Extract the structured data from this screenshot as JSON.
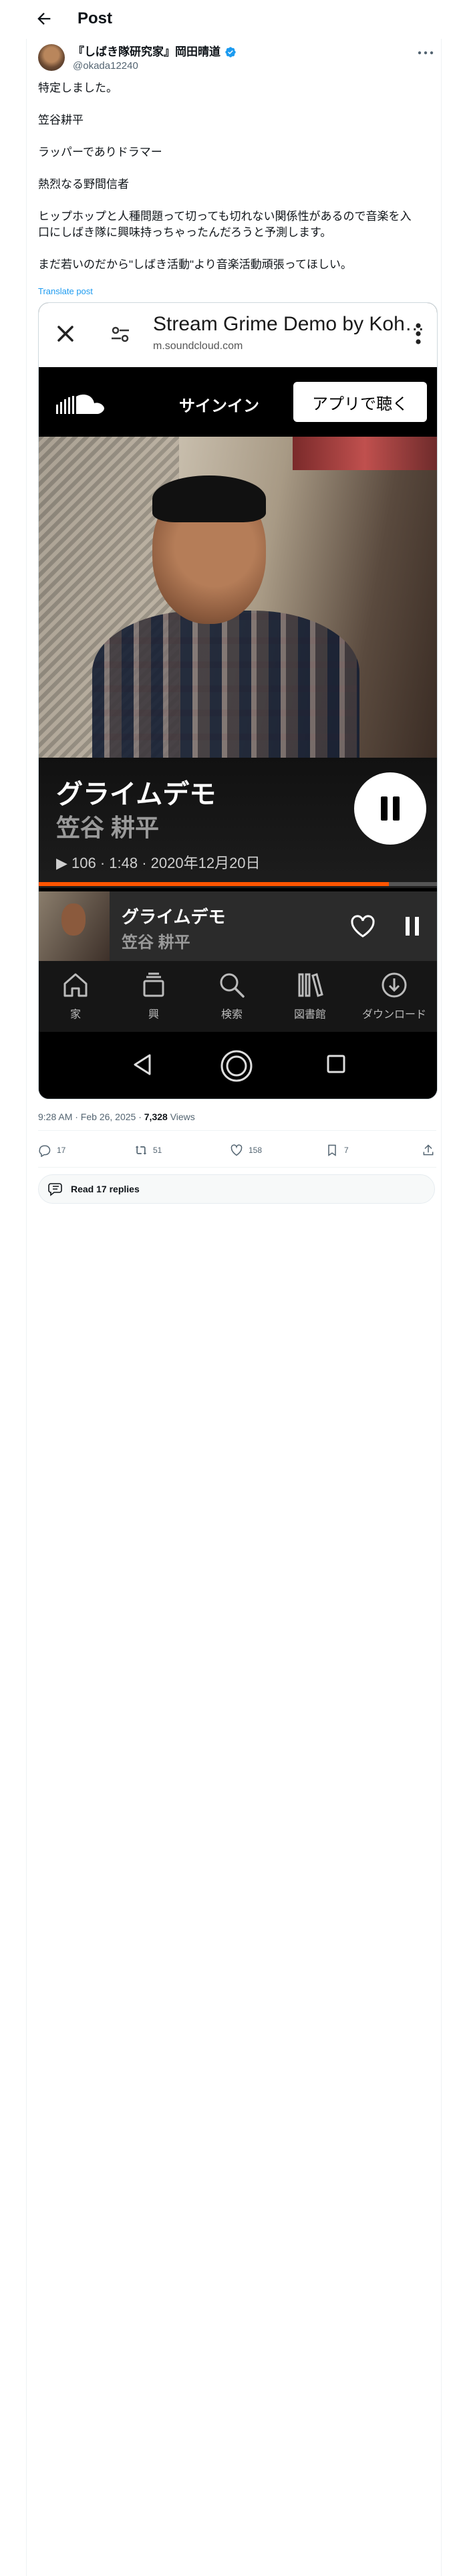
{
  "header": {
    "title": "Post"
  },
  "author": {
    "name": "『しばき隊研究家』岡田晴道",
    "handle": "@okada12240",
    "verified_color": "#1d9bf0"
  },
  "post": {
    "lines": [
      "特定しました。",
      "",
      "笠谷耕平",
      "",
      "ラッパーでありドラマー",
      "",
      "熱烈なる野間信者",
      "",
      "ヒップホップと人種問題って切っても切れない関係性があるので音楽を入",
      "口にしばき隊に興味持っちゃったんだろうと予測します。",
      "",
      "まだ若いのだから\"しばき活動\"より音楽活動頑張ってほしい。"
    ],
    "translate_label": "Translate post",
    "timestamp": "9:28 AM · Feb 26, 2025 · ",
    "views_count": "7,328",
    "views_label": " Views"
  },
  "embed": {
    "browser": {
      "page_title": "Stream Grime Demo by Koh…",
      "url": "m.soundcloud.com"
    },
    "soundcloud": {
      "signin_label": "サインイン",
      "listen_in_app_label": "アプリで聴く",
      "track_title": "グライムデモ",
      "track_artist": "笠谷 耕平",
      "track_meta": "▶ 106 · 1:48 · 2020年12月20日",
      "progress_fraction": 0.88,
      "accent_color": "#ff5500"
    },
    "tabs": [
      {
        "icon": "home-icon",
        "label": "家"
      },
      {
        "icon": "feed-icon",
        "label": "興"
      },
      {
        "icon": "search-icon",
        "label": "検索"
      },
      {
        "icon": "library-icon",
        "label": "図書館"
      },
      {
        "icon": "download-icon",
        "label": "ダウンロード"
      }
    ]
  },
  "actions": {
    "replies": "17",
    "reposts": "51",
    "likes": "158",
    "bookmarks": "7"
  },
  "read_replies_label": "Read 17 replies"
}
